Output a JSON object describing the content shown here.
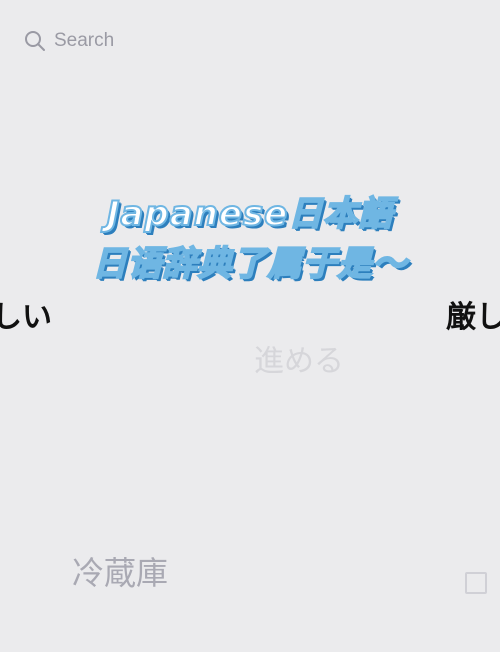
{
  "search": {
    "placeholder": "Search",
    "icon": "search-icon"
  },
  "title": {
    "line1": "Japanese日本語",
    "line2": "日语辞典了属于是～"
  },
  "words": {
    "left": "しい",
    "right": "厳し",
    "middle": "進める",
    "bottom": "冷蔵庫"
  },
  "colors": {
    "background": "#ebebed",
    "title_stroke": "#6fb6e3",
    "title_shadow": "#2d7fbd"
  }
}
